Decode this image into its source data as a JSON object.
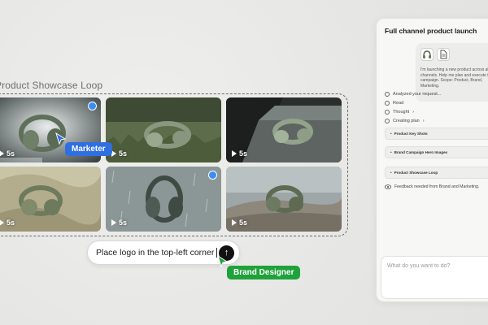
{
  "board": {
    "title": "Product Showcase Loop"
  },
  "tiles": [
    {
      "duration": "5s",
      "selected": true
    },
    {
      "duration": "5s",
      "selected": false
    },
    {
      "duration": "5s",
      "selected": false
    },
    {
      "duration": "5s",
      "selected": false
    },
    {
      "duration": "5s",
      "selected": true
    },
    {
      "duration": "5s",
      "selected": false
    }
  ],
  "cursors": {
    "marketer": "Marketer",
    "brand_designer": "Brand Designer"
  },
  "prompt": {
    "text": "Place logo in the top-left corner",
    "send_icon": "arrow-up-icon"
  },
  "panel": {
    "title": "Full channel product launch",
    "message": "I'm launching a new product across all channels. Help me plan and execute the campaign. Scope: Product, Brand, Marketing.",
    "steps": [
      {
        "label": "Analyzed your request...",
        "icon": "link-icon"
      },
      {
        "label": "Read",
        "icon": "eye-icon"
      },
      {
        "label": "Thought",
        "icon": "bulb-icon"
      },
      {
        "label": "Creating plan",
        "icon": "list-icon"
      }
    ],
    "plan_items": [
      "Product Key Shots",
      "Brand Campaign Hero Images",
      "Product Showcase Loop"
    ],
    "feedback": "Feedback needed from Brand and Marketing.",
    "input_placeholder": "What do you want to do?"
  },
  "colors": {
    "selection_blue": "#3a8df5",
    "marketer_tag": "#2f6fe0",
    "designer_tag": "#1fa23a"
  }
}
